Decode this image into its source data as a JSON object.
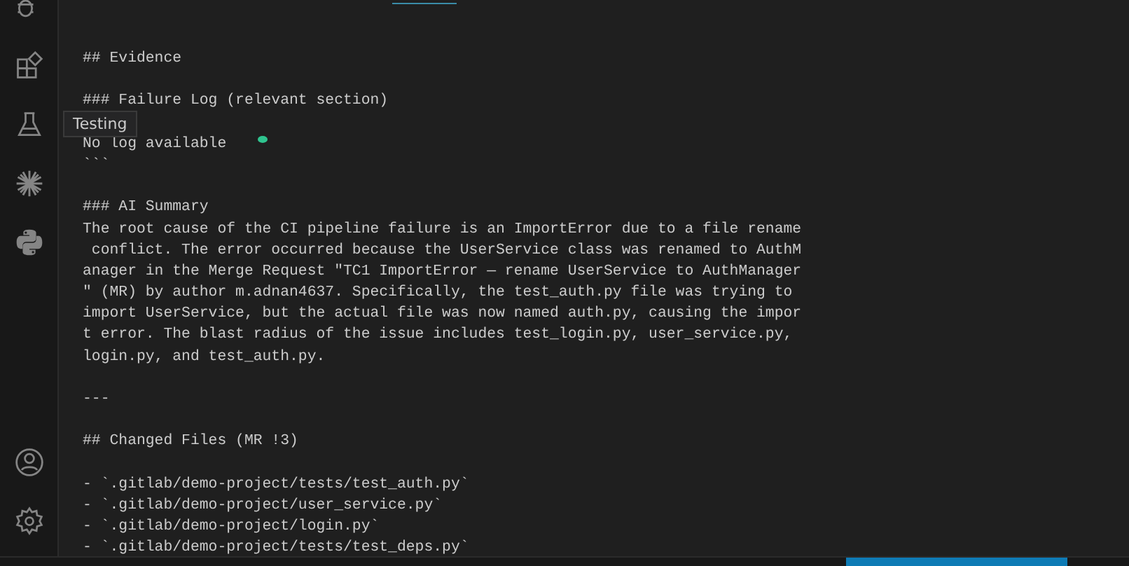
{
  "activity_bar": {
    "items": [
      {
        "kind": "debug"
      },
      {
        "kind": "extensions"
      },
      {
        "kind": "testing",
        "tooltip": "Testing"
      },
      {
        "kind": "sparkle"
      },
      {
        "kind": "python"
      }
    ],
    "bottom_items": [
      {
        "kind": "account"
      },
      {
        "kind": "settings"
      }
    ]
  },
  "editor": {
    "blocks": [
      [
        "## Evidence"
      ],
      [
        "### Failure Log (relevant section)"
      ],
      [
        "No log available",
        "```"
      ],
      [
        "### AI Summary",
        "The root cause of the CI pipeline failure is an ImportError due to a file rename",
        " conflict. The error occurred because the UserService class was renamed to AuthM",
        "anager in the Merge Request \"TC1 ImportError — rename UserService to AuthManager",
        "\" (MR) by author m.adnan4637. Specifically, the test_auth.py file was trying to",
        "import UserService, but the actual file was now named auth.py, causing the impor",
        "t error. The blast radius of the issue includes test_login.py, user_service.py,",
        "login.py, and test_auth.py."
      ],
      [
        "---"
      ],
      [
        "## Changed Files (MR !3)"
      ],
      [
        "- `.gitlab/demo-project/tests/test_auth.py`",
        "- `.gitlab/demo-project/user_service.py`",
        "- `.gitlab/demo-project/login.py`",
        "- `.gitlab/demo-project/tests/test_deps.py`"
      ]
    ]
  }
}
